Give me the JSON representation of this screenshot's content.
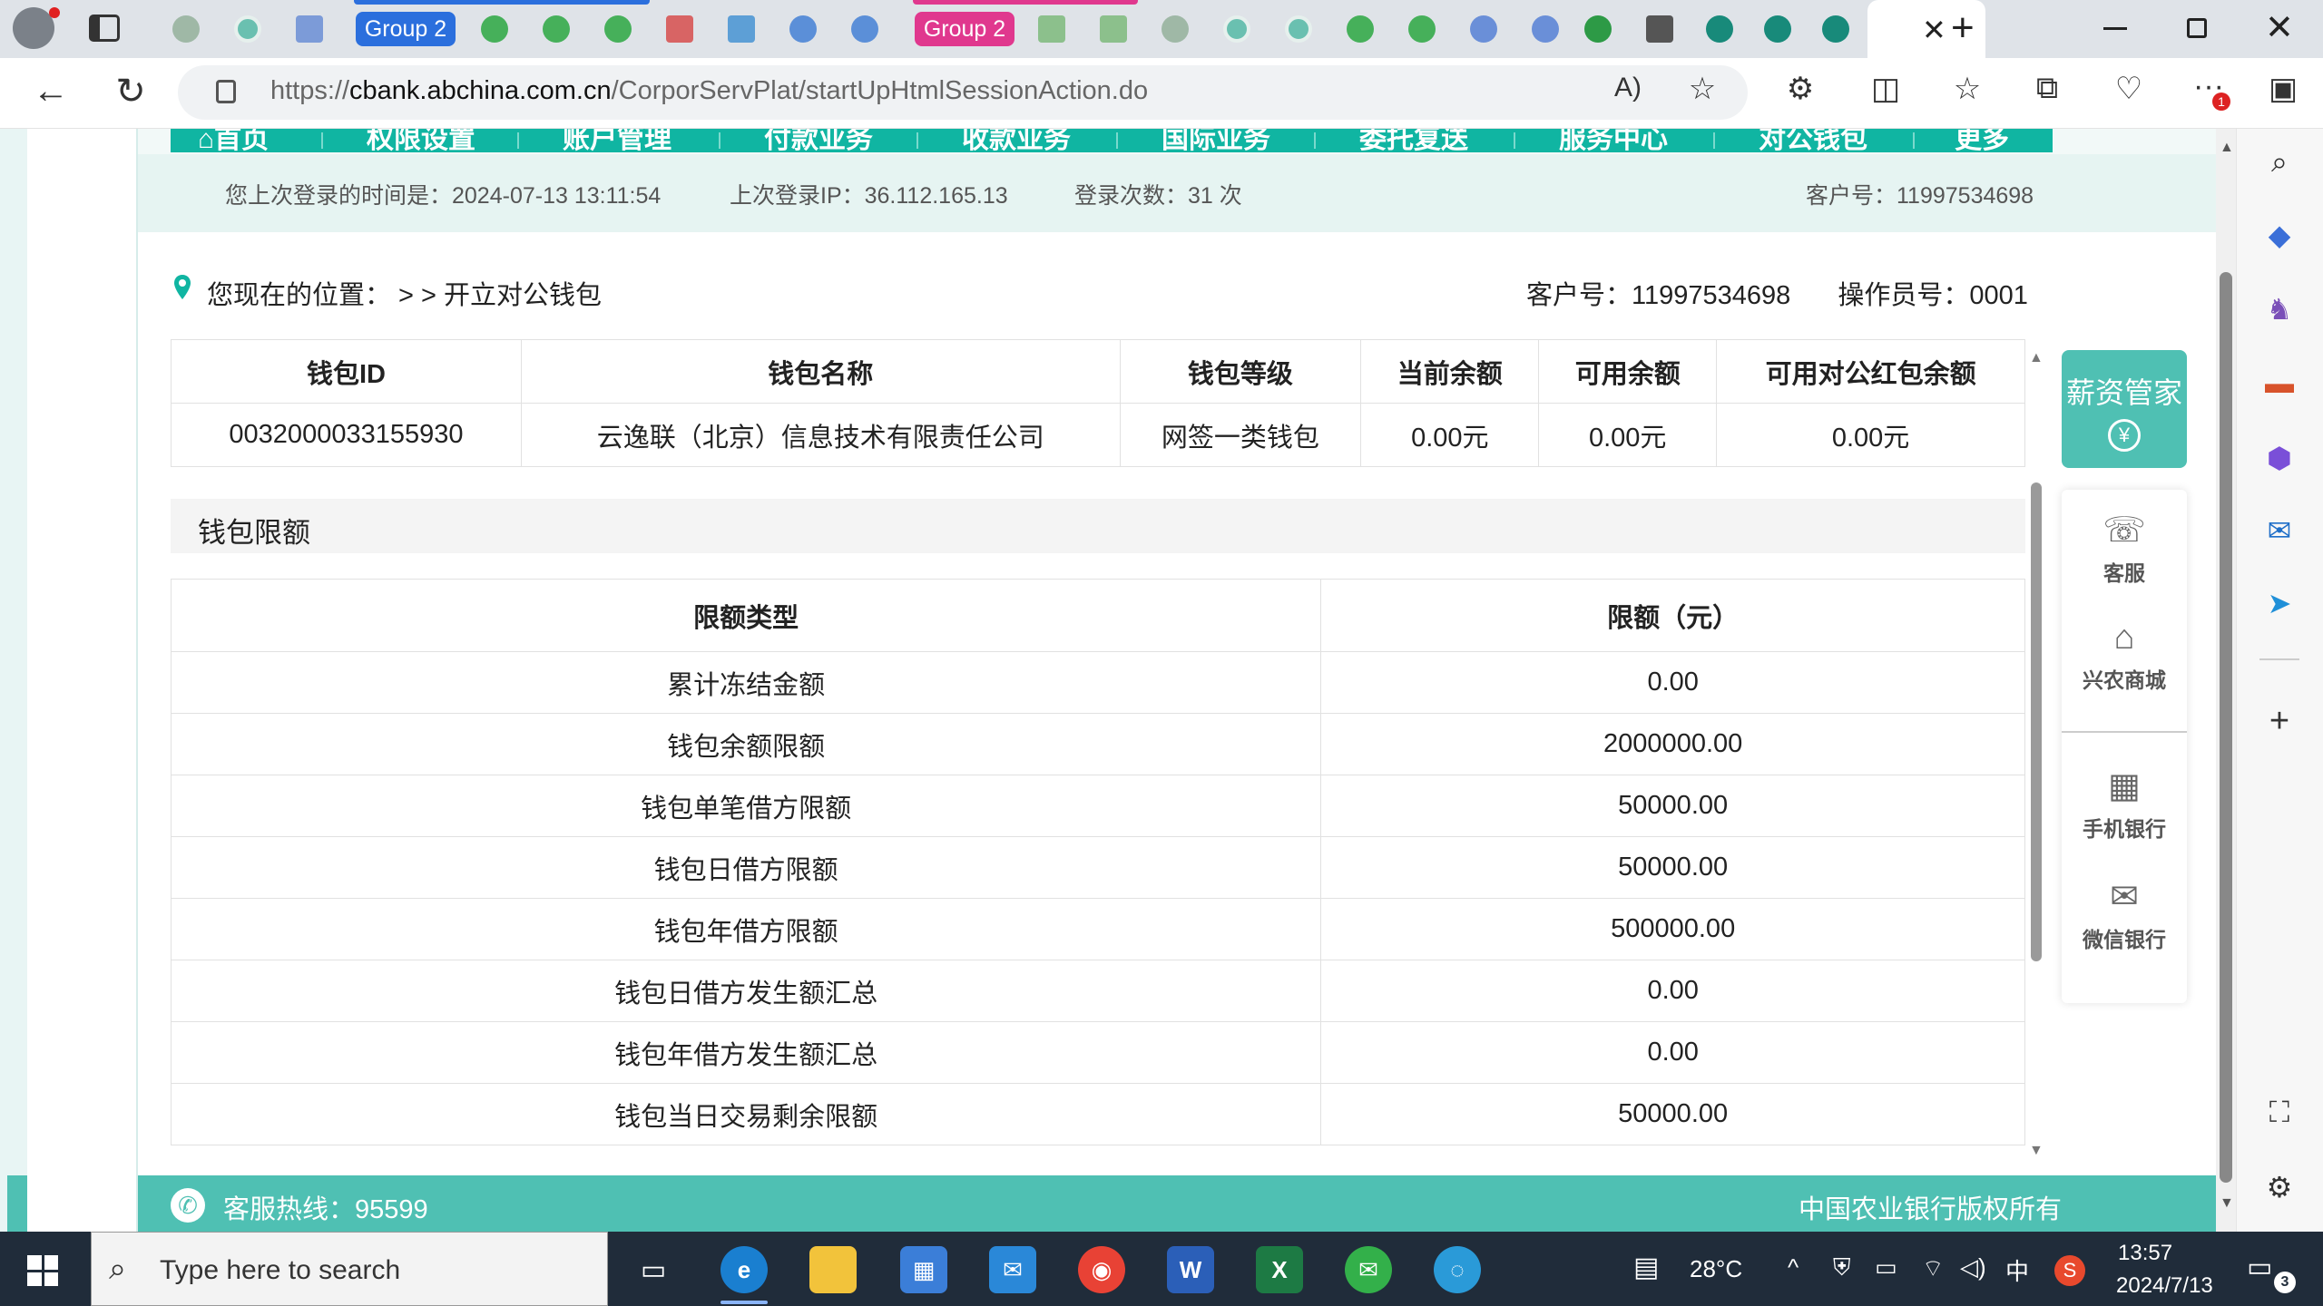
{
  "browser": {
    "tab_groups": [
      {
        "label": "Group 2",
        "color": "#2b6fdd"
      },
      {
        "label": "Group 2",
        "color": "#e0388e"
      }
    ],
    "url_prefix": "https://",
    "url_host": "cbank.abchina.com.cn",
    "url_path": "/CorporServPlat/startUpHtmlSessionAction.do",
    "active_tab_close": "✕"
  },
  "bank": {
    "menu": [
      "首页",
      "权限设置",
      "账户管理",
      "付款业务",
      "收款业务",
      "国际业务",
      "委托复送",
      "服务中心",
      "对公钱包",
      "更多"
    ],
    "last_login_time": "您上次登录的时间是：2024-07-13 13:11:54",
    "last_login_ip": "上次登录IP：36.112.165.13",
    "login_count": "登录次数：31 次",
    "customer_no_top": "客户号：11997534698",
    "breadcrumb": "您现在的位置：  > > 开立对公钱包",
    "customer_no": "客户号：11997534698",
    "operator_no": "操作员号：0001",
    "wallet_headers": [
      "钱包ID",
      "钱包名称",
      "钱包等级",
      "当前余额",
      "可用余额",
      "可用对公红包余额"
    ],
    "wallet_row": [
      "0032000033155930",
      "云逸联（北京）信息技术有限责任公司",
      "网签一类钱包",
      "0.00元",
      "0.00元",
      "0.00元"
    ],
    "limits_title": "钱包限额",
    "limit_headers": [
      "限额类型",
      "限额（元）"
    ],
    "limit_rows": [
      [
        "累计冻结金额",
        "0.00"
      ],
      [
        "钱包余额限额",
        "2000000.00"
      ],
      [
        "钱包单笔借方限额",
        "50000.00"
      ],
      [
        "钱包日借方限额",
        "50000.00"
      ],
      [
        "钱包年借方限额",
        "500000.00"
      ],
      [
        "钱包日借方发生额汇总",
        "0.00"
      ],
      [
        "钱包年借方发生额汇总",
        "0.00"
      ],
      [
        "钱包当日交易剩余限额",
        "50000.00"
      ]
    ],
    "float_panel": {
      "top": "薪资管家",
      "items": [
        "客服",
        "兴农商城",
        "手机银行",
        "微信银行"
      ]
    },
    "hotline": "客服热线：95599",
    "copyright": "中国农业银行版权所有"
  },
  "taskbar": {
    "search_placeholder": "Type here to search",
    "temperature": "28°C",
    "ime": "中",
    "time": "13:57",
    "date": "2024/7/13",
    "notifications": "3"
  },
  "colors": {
    "teal": "#10b5a2",
    "teal_light": "#4fc0b3"
  }
}
